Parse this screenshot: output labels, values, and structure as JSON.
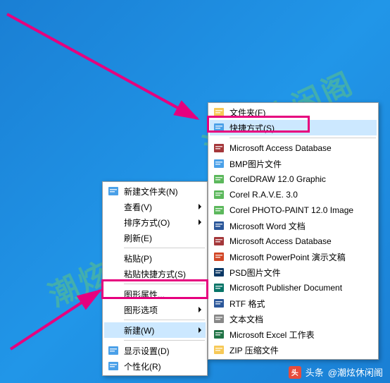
{
  "watermark": "潮炫休闲阁",
  "footer": {
    "prefix": "头条",
    "account": "@潮炫休闲阁"
  },
  "menu1": {
    "items": [
      {
        "label": "新建文件夹(N)",
        "icon": "share-icon",
        "submenu": false
      },
      {
        "label": "查看(V)",
        "icon": null,
        "submenu": true
      },
      {
        "label": "排序方式(O)",
        "icon": null,
        "submenu": true
      },
      {
        "label": "刷新(E)",
        "icon": null,
        "submenu": false
      },
      {
        "sep": true
      },
      {
        "label": "粘贴(P)",
        "icon": null,
        "submenu": false
      },
      {
        "label": "粘贴快捷方式(S)",
        "icon": null,
        "submenu": false
      },
      {
        "sep": true
      },
      {
        "label": "图形属性...",
        "icon": null,
        "submenu": false
      },
      {
        "label": "图形选项",
        "icon": null,
        "submenu": true
      },
      {
        "sep": true
      },
      {
        "label": "新建(W)",
        "icon": null,
        "submenu": true,
        "hover": true
      },
      {
        "sep": true
      },
      {
        "label": "显示设置(D)",
        "icon": "display-icon",
        "submenu": false
      },
      {
        "label": "个性化(R)",
        "icon": "personalize-icon",
        "submenu": false
      }
    ]
  },
  "menu2": {
    "items": [
      {
        "label": "文件夹(F)",
        "icon": "folder-icon"
      },
      {
        "label": "快捷方式(S)",
        "icon": "shortcut-icon",
        "hover": true
      },
      {
        "sep": true
      },
      {
        "label": "Microsoft Access Database",
        "icon": "access-icon"
      },
      {
        "label": "BMP图片文件",
        "icon": "bmp-icon"
      },
      {
        "label": "CorelDRAW 12.0 Graphic",
        "icon": "cdr-icon"
      },
      {
        "label": "Corel R.A.V.E. 3.0",
        "icon": "rave-icon"
      },
      {
        "label": "Corel PHOTO-PAINT 12.0 Image",
        "icon": "cpt-icon"
      },
      {
        "label": "Microsoft Word 文档",
        "icon": "word-icon"
      },
      {
        "label": "Microsoft Access Database",
        "icon": "access-icon"
      },
      {
        "label": "Microsoft PowerPoint 演示文稿",
        "icon": "ppt-icon"
      },
      {
        "label": "PSD图片文件",
        "icon": "psd-icon"
      },
      {
        "label": "Microsoft Publisher Document",
        "icon": "pub-icon"
      },
      {
        "label": "RTF 格式",
        "icon": "rtf-icon"
      },
      {
        "label": "文本文档",
        "icon": "txt-icon"
      },
      {
        "label": "Microsoft Excel 工作表",
        "icon": "excel-icon"
      },
      {
        "label": "ZIP 压缩文件",
        "icon": "zip-icon"
      }
    ]
  },
  "colors": {
    "arrow": "#e6007e",
    "highlight": "#e6007e",
    "hover": "#cce8ff"
  }
}
